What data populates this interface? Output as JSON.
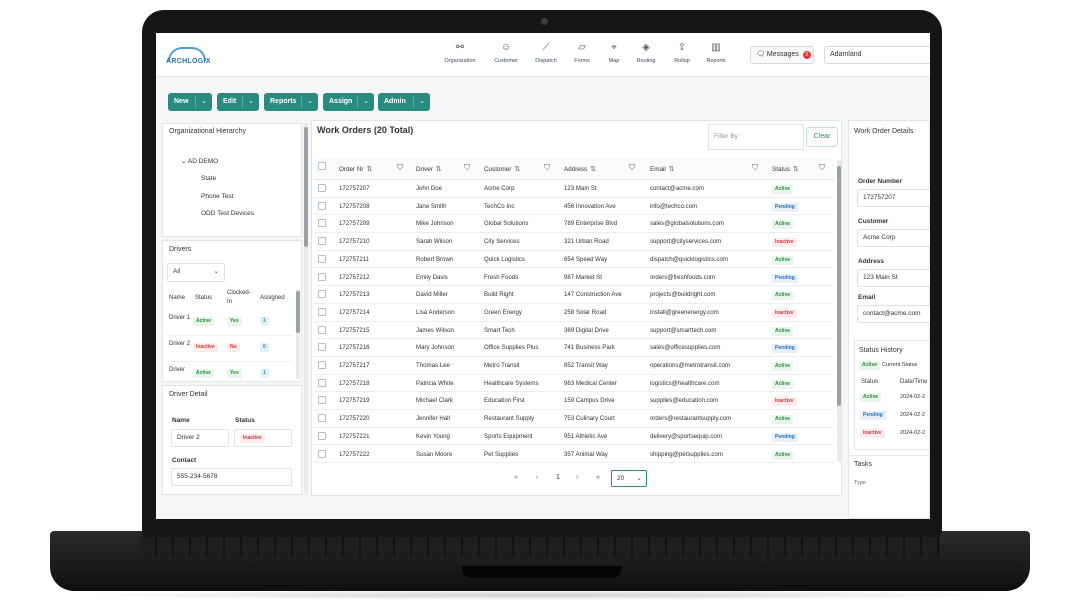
{
  "app": {
    "logo_text": "ARCHLOGIX",
    "brand_color": "#2a8b80"
  },
  "nav": [
    {
      "label": "Organization",
      "icon": "organization-icon",
      "glyph": "⚯"
    },
    {
      "label": "Customer",
      "icon": "customer-icon",
      "glyph": "☺"
    },
    {
      "label": "Dispatch",
      "icon": "dispatch-icon",
      "glyph": "⟋"
    },
    {
      "label": "Forms",
      "icon": "forms-icon",
      "glyph": "▱"
    },
    {
      "label": "Map",
      "icon": "map-pin-icon",
      "glyph": "⌖"
    },
    {
      "label": "Routing",
      "icon": "routing-icon",
      "glyph": "◈"
    },
    {
      "label": "Rollup",
      "icon": "rollup-icon",
      "glyph": "⇪"
    },
    {
      "label": "Reports",
      "icon": "reports-icon",
      "glyph": "▥"
    }
  ],
  "messages": {
    "label": "Messages",
    "count": "3"
  },
  "org_select": {
    "value": "Adamland"
  },
  "toolbar": {
    "new": "New",
    "edit": "Edit",
    "reports": "Reports",
    "assign": "Assign",
    "admin": "Admin"
  },
  "hierarchy": {
    "title": "Organizational Hierarchy",
    "root": "AD DEMO",
    "children": [
      "State",
      "Phone Test",
      "ODD Test Devices"
    ]
  },
  "drivers": {
    "title": "Drivers",
    "filter": "All",
    "columns": [
      "Name",
      "Status",
      "Clocked-In",
      "Assigned"
    ],
    "rows": [
      {
        "name": "Driver 1",
        "status": "Active",
        "clocked": "Yes",
        "assigned": "3"
      },
      {
        "name": "Driver 2",
        "status": "Inactive",
        "clocked": "No",
        "assigned": "0"
      },
      {
        "name": "Driver",
        "status": "Active",
        "clocked": "Yes",
        "assigned": "1"
      }
    ]
  },
  "driver_detail": {
    "title": "Driver Detail",
    "name_label": "Name",
    "name_value": "Driver 2",
    "status_label": "Status",
    "status_value": "Inactive",
    "contact_label": "Contact",
    "contact_value": "555-234-5678"
  },
  "work_orders": {
    "title": "Work Orders (20 Total)",
    "filter_placeholder": "Filter By",
    "clear_label": "Clear",
    "columns": [
      "Order Nr",
      "Driver",
      "Customer",
      "Address",
      "Email",
      "Status"
    ],
    "rows": [
      [
        "172757207",
        "John Doe",
        "Acme Corp",
        "123 Main St",
        "contact@acme.com",
        "Active"
      ],
      [
        "172757208",
        "Jane Smith",
        "TechCo Inc",
        "456 Innovation Ave",
        "info@techco.com",
        "Pending"
      ],
      [
        "172757209",
        "Mike Johnson",
        "Global Solutions",
        "789 Enterprise Blvd",
        "sales@globalsolutions.com",
        "Active"
      ],
      [
        "172757210",
        "Sarah Wilson",
        "City Services",
        "321 Urban Road",
        "support@cityservices.com",
        "Inactive"
      ],
      [
        "172757211",
        "Robert Brown",
        "Quick Logistics",
        "654 Speed Way",
        "dispatch@quicklogistics.com",
        "Active"
      ],
      [
        "172757212",
        "Emily Davis",
        "Fresh Foods",
        "987 Market St",
        "orders@freshfoods.com",
        "Pending"
      ],
      [
        "172757213",
        "David Miller",
        "Build Right",
        "147 Construction Ave",
        "projects@buildright.com",
        "Active"
      ],
      [
        "172757214",
        "Lisa Anderson",
        "Green Energy",
        "258 Solar Road",
        "install@greenenergy.com",
        "Inactive"
      ],
      [
        "172757215",
        "James Wilson",
        "Smart Tech",
        "369 Digital Drive",
        "support@smarttech.com",
        "Active"
      ],
      [
        "172757216",
        "Mary Johnson",
        "Office Supplies Plus",
        "741 Business Park",
        "sales@officesupplies.com",
        "Pending"
      ],
      [
        "172757217",
        "Thomas Lee",
        "Metro Transit",
        "852 Transit Way",
        "operations@metrotransit.com",
        "Active"
      ],
      [
        "172757218",
        "Patricia White",
        "Healthcare Systems",
        "963 Medical Center",
        "logistics@healthcare.com",
        "Active"
      ],
      [
        "172757219",
        "Michael Clark",
        "Education First",
        "159 Campus Drive",
        "supplies@education.com",
        "Inactive"
      ],
      [
        "172757220",
        "Jennifer Hall",
        "Restaurant Supply",
        "753 Culinary Court",
        "orders@restaurantsupply.com",
        "Active"
      ],
      [
        "172757221",
        "Kevin Young",
        "Sports Equipment",
        "951 Athletic Ave",
        "delivery@sportsequip.com",
        "Pending"
      ],
      [
        "172757222",
        "Susan Moore",
        "Pet Supplies",
        "357 Animal Way",
        "shipping@petsupplies.com",
        "Active"
      ]
    ],
    "pager": {
      "first": "«",
      "prev": "‹",
      "page": "1",
      "next": "›",
      "last": "»",
      "page_size": "20"
    }
  },
  "details": {
    "title": "Work Order Details",
    "order_label": "Order Number",
    "order_value": "172757207",
    "customer_label": "Customer",
    "customer_value": "Acme Corp",
    "address_label": "Address",
    "address_value": "123 Main St",
    "email_label": "Email",
    "email_value": "contact@acme.com",
    "history_title": "Status History",
    "current_badge": "Active",
    "current_label": "Current Status",
    "history_cols": [
      "Status",
      "Date/Time"
    ],
    "history_rows": [
      {
        "status": "Active",
        "date": "2024-02-2"
      },
      {
        "status": "Pending",
        "date": "2024-02-2"
      },
      {
        "status": "Inactive",
        "date": "2024-02-2"
      }
    ],
    "tasks_title": "Tasks",
    "tasks_col": "Type"
  }
}
